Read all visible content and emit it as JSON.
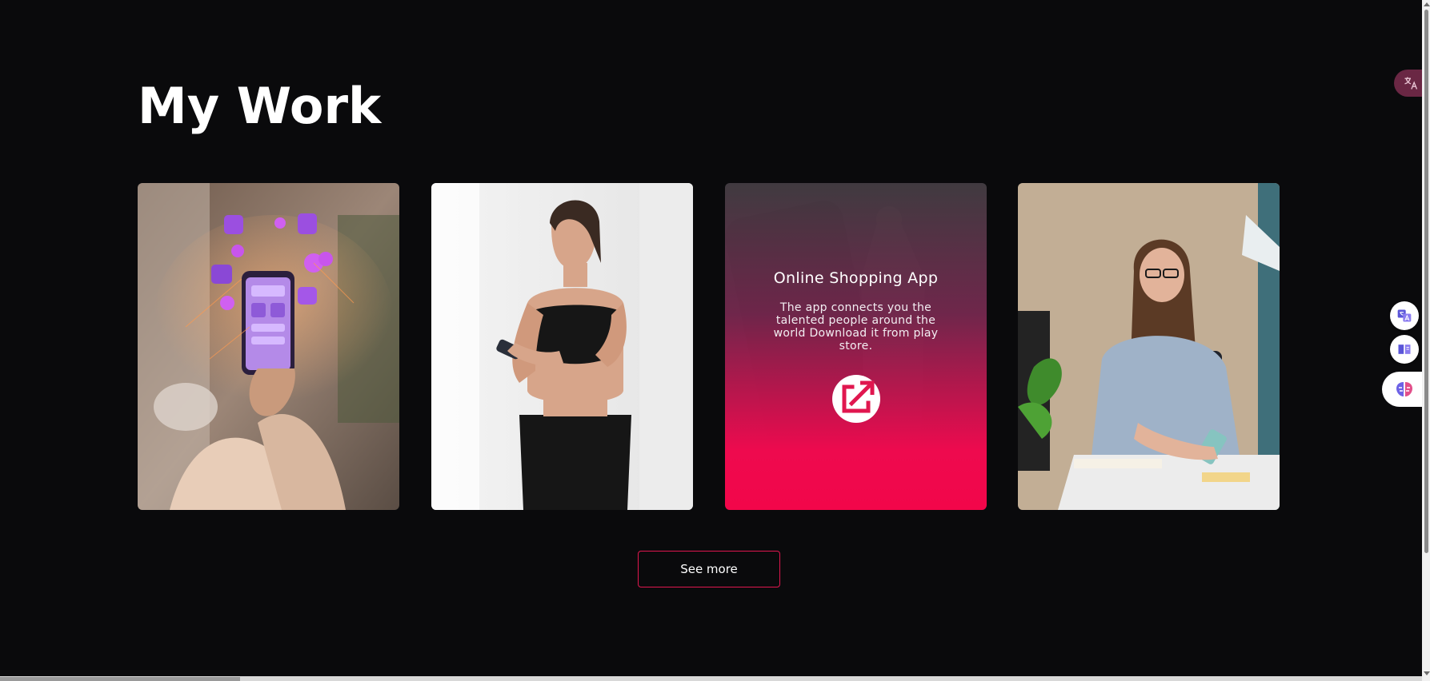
{
  "section": {
    "title": "My Work"
  },
  "cards": [
    {
      "image": "phone-social-media-photo"
    },
    {
      "image": "woman-fitness-phone-photo"
    },
    {
      "image": "shopping-app-photo",
      "title": "Online Shopping App",
      "description": "The app connects you the talented people around the world Download it from play store.",
      "link_icon": "external-link-icon"
    },
    {
      "image": "woman-office-phone-photo"
    }
  ],
  "see_more": {
    "label": "See more"
  },
  "colors": {
    "background": "#0a0a0c",
    "accent": "#e0174f",
    "overlay_bottom": "#f2064a"
  },
  "side_widgets": [
    "translate-icon",
    "translate-icon",
    "reader-icon",
    "brain-icon"
  ]
}
